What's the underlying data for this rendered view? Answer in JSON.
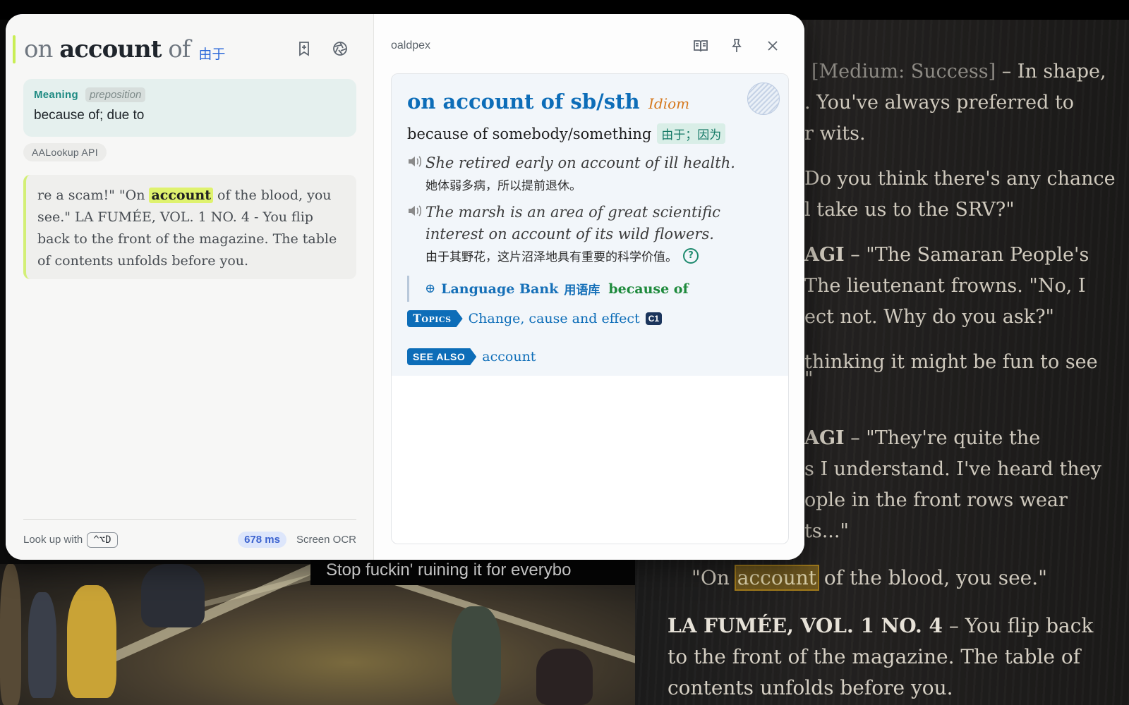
{
  "background": {
    "subtitle": "Stop fuckin' ruining it for everybo",
    "dialogue": [
      {
        "pre_dim": "[Medium: Success]",
        "rest": " – In shape,"
      },
      {
        "pre_dim": "",
        "rest": ". You've always preferred to"
      },
      {
        "pre_dim": "",
        "rest": "r wits."
      },
      {
        "pre_dim": "",
        "rest": "Do you think there's any chance"
      },
      {
        "pre_dim": "",
        "rest": "l take us to the SRV?\""
      },
      {
        "pre_dim": "",
        "speaker": "AGI",
        "rest": " – \"The Samaran People's"
      },
      {
        "pre_dim": "",
        "rest": "The lieutenant frowns. \"No, I"
      },
      {
        "pre_dim": "",
        "rest": "ect not. Why do you ask?\""
      },
      {
        "pre_dim": "",
        "rest": "thinking it might be fun to see"
      },
      {
        "pre_dim": "",
        "rest": "\""
      },
      {
        "pre_dim": "",
        "speaker": "AGI",
        "rest": " – \"They're quite the"
      },
      {
        "pre_dim": "",
        "rest": "s I understand. I've heard they"
      },
      {
        "pre_dim": "",
        "rest": "ople in the front rows wear"
      },
      {
        "pre_dim": "",
        "rest": "ts...\""
      }
    ],
    "quote_pre": "\"On ",
    "quote_hl": "account",
    "quote_post": " of the blood, you see.\"",
    "la_speaker": "LA FUMÉE, VOL. 1 NO. 4",
    "la_text": " – You flip back to the front of the magazine. The table of contents unfolds before you."
  },
  "left": {
    "title_pre": "on ",
    "title_bold": "account",
    "title_post": " of",
    "title_zh": "由于",
    "meaning_label": "Meaning",
    "pos": "preposition",
    "definition": "because of; due to",
    "api": "AALookup API",
    "context_pre": "re a scam!\" \"On ",
    "context_hl": "account",
    "context_post": " of the blood, you see.\" LA FUMÉE, VOL. 1 NO. 4 - You flip back to the front of the magazine. The table of contents unfolds before you.",
    "lookup_label": "Look up with",
    "shortcut": "^⌥D",
    "latency": "678 ms",
    "mode": "Screen OCR"
  },
  "right": {
    "source": "oaldpex",
    "headword": "on account of sb/sth",
    "tag": "Idiom",
    "definition": "because of somebody/something",
    "definition_zh": "由于；因为",
    "examples": [
      {
        "en": "She retired early on account of ill health.",
        "zh": "她体弱多病，所以提前退休。"
      },
      {
        "en": "The marsh is an area of great scientific interest on account of its wild flowers.",
        "zh": "由于其野花，这片沼泽地具有重要的科学价值。"
      }
    ],
    "help": "?",
    "lang_bank_plus": "⊕",
    "lang_bank_label": "Language Bank",
    "lang_bank_zh": "用语库",
    "lang_bank_link": "because of",
    "topics_tag": "Topics",
    "topics_text": "Change, cause and effect",
    "topics_level": "C1",
    "see_also_tag": "SEE ALSO",
    "see_also_link": "account"
  },
  "colors": {
    "accent": "#0d6db8",
    "highlight": "#dff26e",
    "teal": "#1e8a82"
  }
}
